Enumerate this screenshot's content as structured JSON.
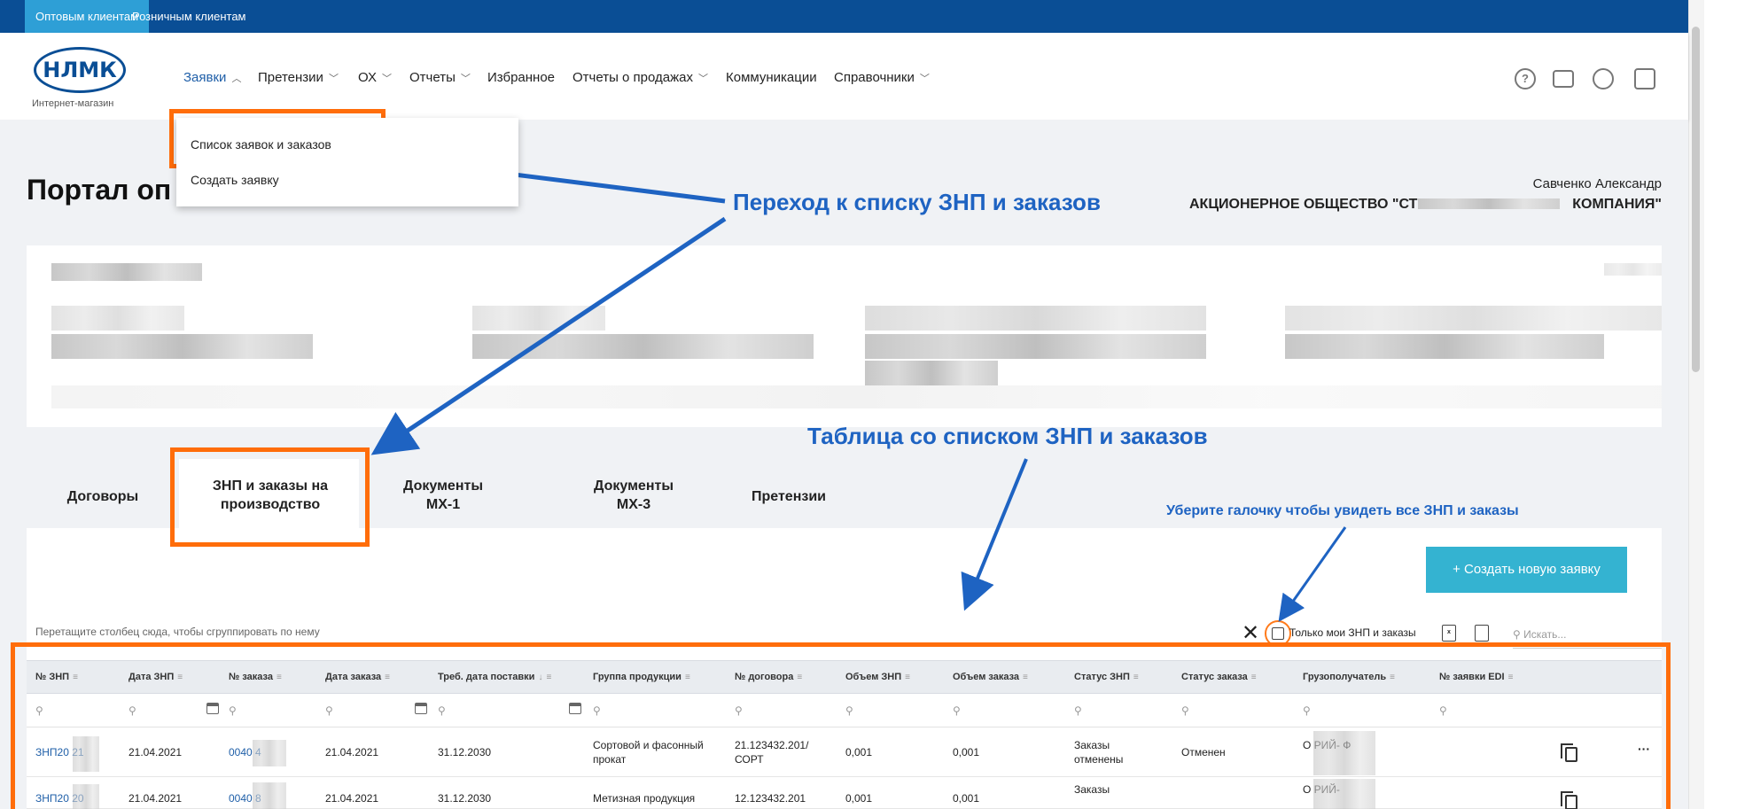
{
  "topbar": {
    "tabs": [
      "Оптовым клиентам",
      "Розничным клиентам"
    ]
  },
  "logo": {
    "text": "НЛМК",
    "subtitle": "Интернет-магазин"
  },
  "nav": [
    "Заявки",
    "Претензии",
    "ОХ",
    "Отчеты",
    "Избранное",
    "Отчеты о продажах",
    "Коммуникации",
    "Справочники"
  ],
  "dropdown": [
    "Список заявок и заказов",
    "Создать заявку"
  ],
  "page": {
    "title": "Портал оп",
    "user": "Савченко Александр",
    "company_left": "АКЦИОНЕРНОЕ ОБЩЕСТВО \"СТ",
    "company_right": "КОМПАНИЯ\""
  },
  "tabs": [
    "Договоры",
    "ЗНП и заказы на производство",
    "Документы МХ-1",
    "Документы МХ-3",
    "Претензии"
  ],
  "toolbar": {
    "create_button": "+ Создать новую заявку",
    "drag_hint": "Перетащите столбец сюда, чтобы сгруппировать по нему",
    "only_mine_label": "Только мои ЗНП и заказы",
    "search_placeholder": "Искать..."
  },
  "table": {
    "columns": [
      "№ ЗНП",
      "Дата ЗНП",
      "№ заказа",
      "Дата заказа",
      "Треб. дата поставки",
      "Группа продукции",
      "№ договора",
      "Объем ЗНП",
      "Объем заказа",
      "Статус ЗНП",
      "Статус заказа",
      "Грузополучатель",
      "№ заявки EDI"
    ],
    "rows": [
      {
        "znp": "ЗНП20 21",
        "date_znp": "21.04.2021",
        "order": "0040 4",
        "date_order": "21.04.2021",
        "delivery": "31.12.2030",
        "group": "Сортовой и фасонный прокат",
        "contract": "21.123432.201/ СОРТ",
        "vol_znp": "0,001",
        "vol_order": "0,001",
        "status_znp": "Заказы отменены",
        "status_order": "Отменен",
        "consignee": "О РИЙ- Ф"
      },
      {
        "znp": "ЗНП20 20",
        "date_znp": "21.04.2021",
        "order": "0040 8",
        "date_order": "21.04.2021",
        "delivery": "31.12.2030",
        "group": "Метизная продукция",
        "contract": "12.123432.201",
        "vol_znp": "0,001",
        "vol_order": "0,001",
        "status_znp": "Заказы",
        "status_order": "",
        "consignee": "О РИЙ-"
      }
    ]
  },
  "annotations": {
    "a1": "Переход к списку ЗНП и заказов",
    "a2": "Таблица со списком ЗНП и заказов",
    "a3": "Уберите галочку чтобы увидеть все ЗНП и заказы"
  },
  "colors": {
    "brand": "#0a4e95",
    "accent": "#2e9fd6",
    "highlight": "#ff6d0a",
    "annotation": "#1e63c2"
  }
}
